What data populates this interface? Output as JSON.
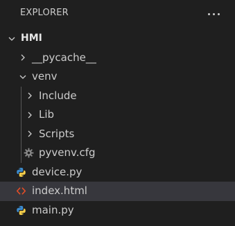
{
  "explorer": {
    "title": "EXPLORER",
    "more_actions_icon": "ellipsis-icon"
  },
  "tree": {
    "root": {
      "label": "HMI",
      "expanded": true,
      "icon": "chevron-down-icon"
    },
    "items": [
      {
        "label": "__pycache__",
        "type": "folder",
        "expanded": false,
        "icon": "chevron-right-icon"
      },
      {
        "label": "venv",
        "type": "folder",
        "expanded": true,
        "icon": "chevron-down-icon"
      },
      {
        "label": "Include",
        "type": "folder",
        "expanded": false,
        "icon": "chevron-right-icon"
      },
      {
        "label": "Lib",
        "type": "folder",
        "expanded": false,
        "icon": "chevron-right-icon"
      },
      {
        "label": "Scripts",
        "type": "folder",
        "expanded": false,
        "icon": "chevron-right-icon"
      },
      {
        "label": "pyvenv.cfg",
        "type": "file",
        "icon": "gear-icon"
      },
      {
        "label": "device.py",
        "type": "file",
        "icon": "python-icon"
      },
      {
        "label": "index.html",
        "type": "file",
        "icon": "html-icon",
        "selected": true
      },
      {
        "label": "main.py",
        "type": "file",
        "icon": "python-icon"
      }
    ]
  },
  "colors": {
    "background": "#1f1f1f",
    "text": "#cccccc",
    "selection": "#37373d",
    "python_blue": "#3c8dd0",
    "python_yellow": "#f6cf4a",
    "html_orange": "#e44d26",
    "gear_gray": "#8a8a8a"
  }
}
